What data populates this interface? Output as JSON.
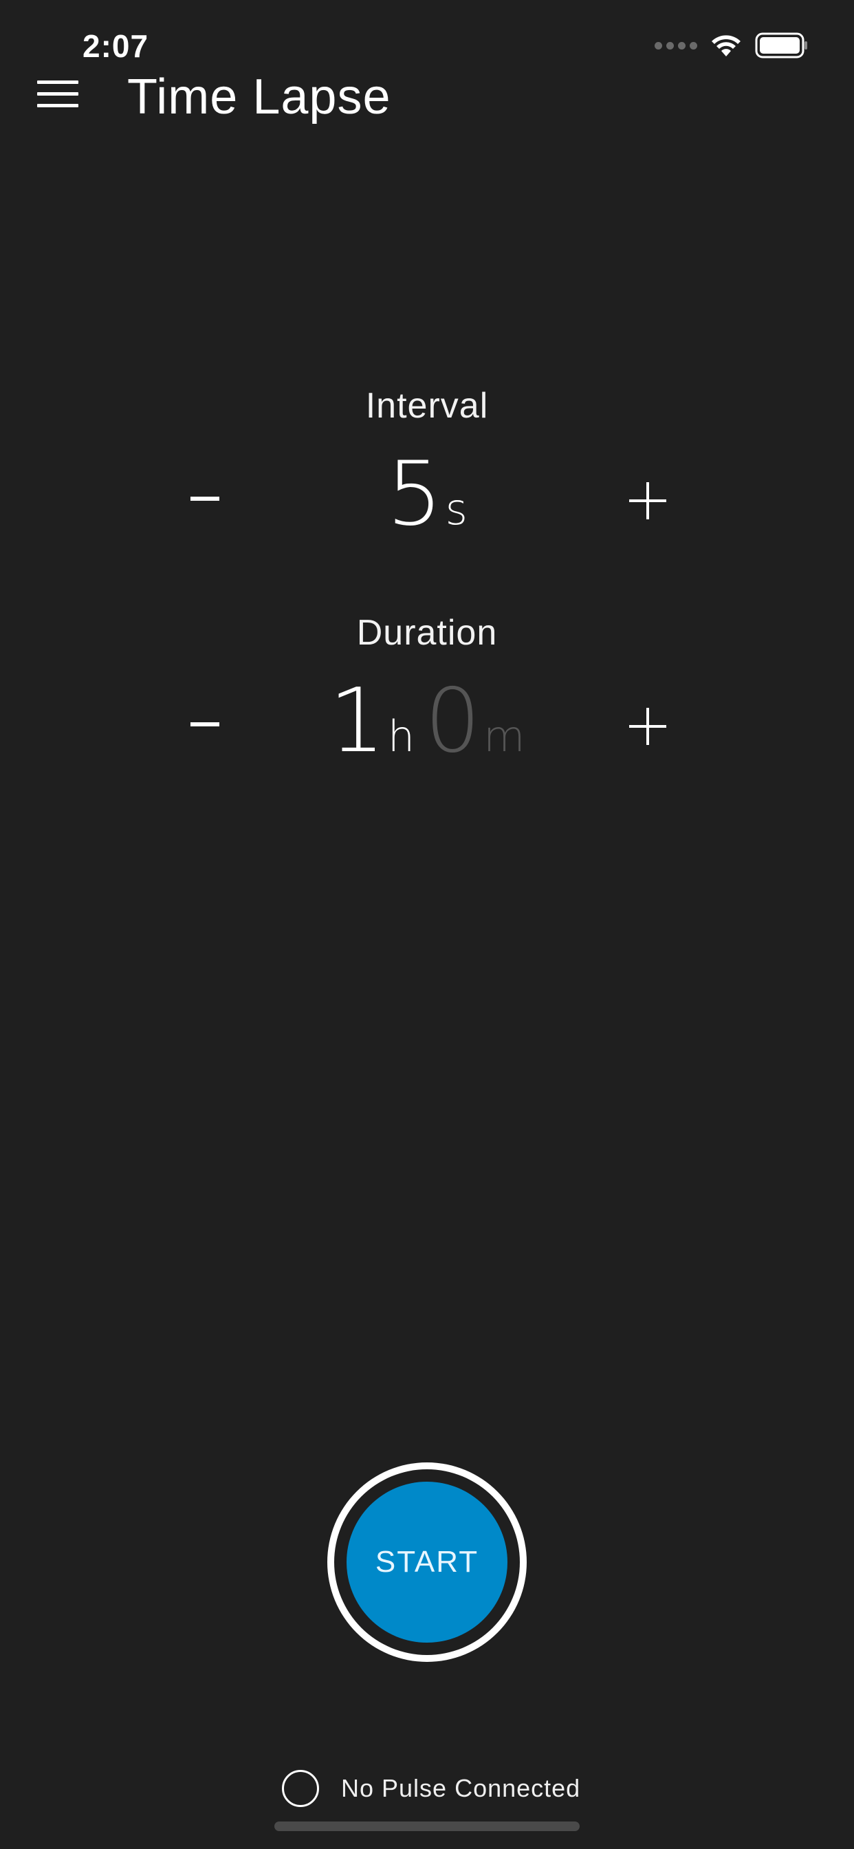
{
  "status_bar": {
    "time": "2:07"
  },
  "header": {
    "title": "Time Lapse",
    "menu_icon": "hamburger-menu-icon"
  },
  "interval": {
    "label": "Interval",
    "value": "5",
    "unit": "s",
    "decrement_label": "-",
    "increment_label": "+"
  },
  "duration": {
    "label": "Duration",
    "hours": "1",
    "hours_unit": "h",
    "minutes": "0",
    "minutes_unit": "m",
    "decrement_label": "-",
    "increment_label": "+"
  },
  "start_button": {
    "label": "START",
    "color": "#0089c9"
  },
  "connection": {
    "status_text": "No Pulse Connected"
  }
}
